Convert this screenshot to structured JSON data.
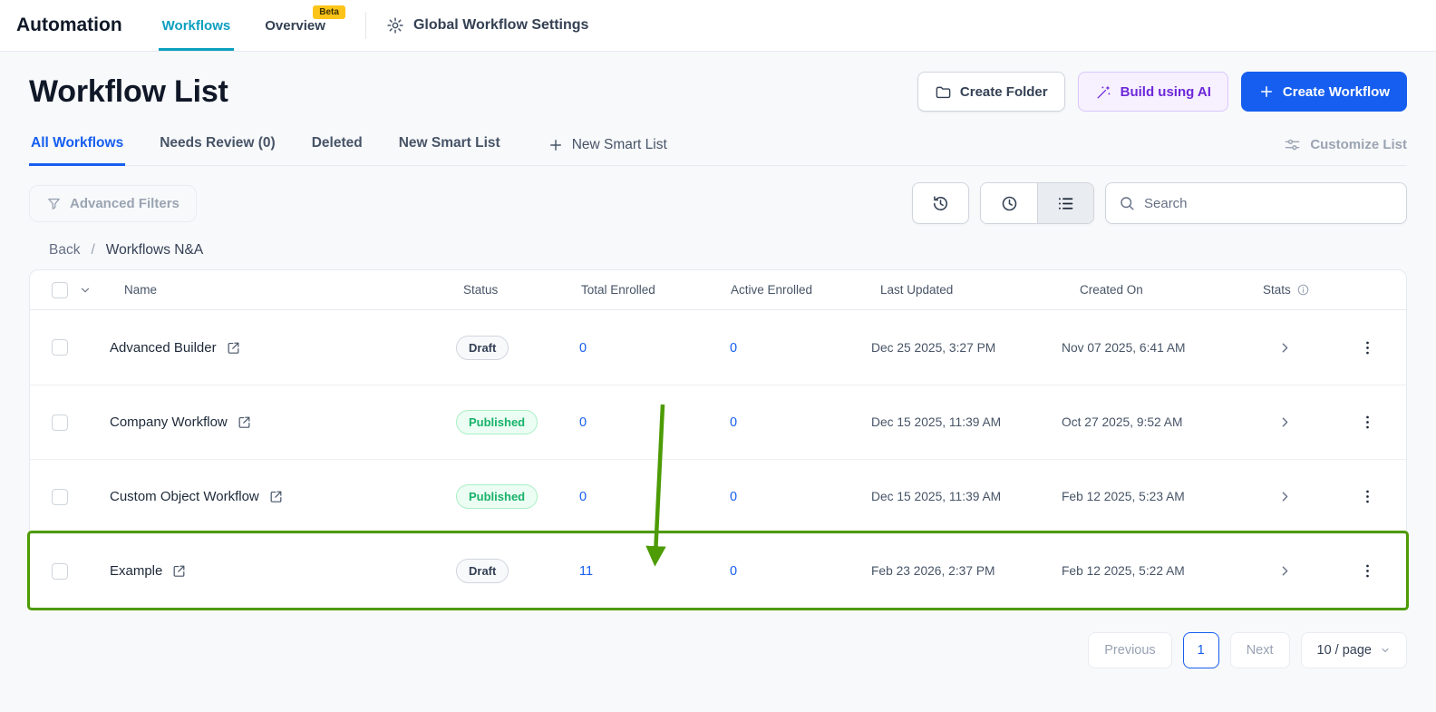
{
  "colors": {
    "accent_blue": "#155eef",
    "active_tab_teal": "#0c9fbf",
    "annotation_green": "#4d9b05",
    "published_green": "#17b26a",
    "beta_yellow": "#fcc419",
    "ai_purple": "#6d28d9"
  },
  "topbar": {
    "app_title": "Automation",
    "workflows_tab": "Workflows",
    "overview_tab": "Overview",
    "beta_badge": "Beta",
    "settings_label": "Global Workflow Settings"
  },
  "header": {
    "title": "Workflow List",
    "create_folder_button": "Create Folder",
    "build_ai_button": "Build using AI",
    "create_workflow_button": "Create Workflow"
  },
  "list_tabs": {
    "all_workflows": "All Workflows",
    "needs_review": "Needs Review (0)",
    "deleted": "Deleted",
    "new_smart_list_tab": "New Smart List",
    "new_smart_list_button": "New Smart List",
    "customize_list": "Customize List"
  },
  "filters": {
    "advanced_filters": "Advanced Filters",
    "search_placeholder": "Search"
  },
  "breadcrumb": {
    "back": "Back",
    "separator": "/",
    "current": "Workflows N&A"
  },
  "table": {
    "columns": [
      "Name",
      "Status",
      "Total Enrolled",
      "Active Enrolled",
      "Last Updated",
      "Created On",
      "Stats"
    ],
    "rows": [
      {
        "name": "Advanced Builder",
        "status": "Draft",
        "status_type": "draft",
        "total_enrolled": "0",
        "active_enrolled": "0",
        "last_updated": "Dec 25 2025, 3:27 PM",
        "created_on": "Nov 07 2025, 6:41 AM",
        "highlighted": false
      },
      {
        "name": "Company Workflow",
        "status": "Published",
        "status_type": "published",
        "total_enrolled": "0",
        "active_enrolled": "0",
        "last_updated": "Dec 15 2025, 11:39 AM",
        "created_on": "Oct 27 2025, 9:52 AM",
        "highlighted": false
      },
      {
        "name": "Custom Object Workflow",
        "status": "Published",
        "status_type": "published",
        "total_enrolled": "0",
        "active_enrolled": "0",
        "last_updated": "Dec 15 2025, 11:39 AM",
        "created_on": "Feb 12 2025, 5:23 AM",
        "highlighted": false
      },
      {
        "name": "Example",
        "status": "Draft",
        "status_type": "draft",
        "total_enrolled": "11",
        "active_enrolled": "0",
        "last_updated": "Feb 23 2026, 2:37 PM",
        "created_on": "Feb 12 2025, 5:22 AM",
        "highlighted": true
      }
    ]
  },
  "pagination": {
    "previous": "Previous",
    "current_page": "1",
    "next": "Next",
    "page_size": "10 / page"
  }
}
